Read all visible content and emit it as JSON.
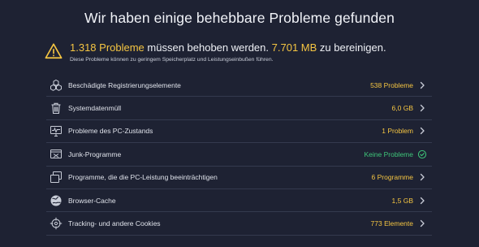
{
  "header": {
    "title": "Wir haben einige behebbare Probleme gefunden"
  },
  "summary": {
    "count": "1.318 Probleme",
    "mid": "müssen behoben werden.",
    "size": "7.701 MB",
    "tail": "zu bereinigen.",
    "note": "Diese Probleme können zu geringem Speicherplatz und Leistungseinbußen führen."
  },
  "colors": {
    "accent": "#f5c542",
    "ok": "#3fc77a",
    "background": "#1e2233"
  },
  "items": [
    {
      "icon": "registry-cubes-icon",
      "label": "Beschädigte Registrierungselemente",
      "value": "538 Probleme",
      "status": "warning"
    },
    {
      "icon": "trash-icon",
      "label": "Systemdatenmüll",
      "value": "6,0 GB",
      "status": "warning"
    },
    {
      "icon": "pc-health-icon",
      "label": "Probleme des PC-Zustands",
      "value": "1 Problem",
      "status": "warning"
    },
    {
      "icon": "junk-programs-icon",
      "label": "Junk-Programme",
      "value": "Keine Probleme",
      "status": "ok"
    },
    {
      "icon": "programs-icon",
      "label": "Programme, die die PC-Leistung beeinträchtigen",
      "value": "6 Programme",
      "status": "warning"
    },
    {
      "icon": "browser-globe-icon",
      "label": "Browser-Cache",
      "value": "1,5 GB",
      "status": "warning"
    },
    {
      "icon": "crosshair-cookie-icon",
      "label": "Tracking- und andere Cookies",
      "value": "773 Elemente",
      "status": "warning"
    }
  ]
}
